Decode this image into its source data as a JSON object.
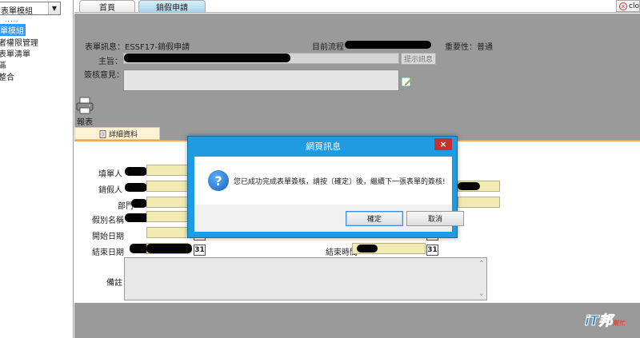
{
  "sidebar": {
    "module_select": "表單模組",
    "dots": ".....",
    "items": [
      "單模組",
      "者權限管理",
      "表單清單",
      "區",
      "整合"
    ]
  },
  "tabs": {
    "home": "首頁",
    "leave": "銷假申請",
    "close_label": "clo"
  },
  "form": {
    "info_label": "表單訊息：ESSF17-銷假申請",
    "flow_label": "目前流程",
    "importance_label": "重要性：普通",
    "manager_label": "主旨：",
    "hint_button": "提示訊息",
    "comment_label": "簽核意見：",
    "report_label": "報表",
    "detail_tab": "詳細資料",
    "applicant_label": "填單人",
    "leave_person_label": "銷假人",
    "dept_label": "部門",
    "leave_type_label": "假別名稱",
    "start_date_label": "開始日期",
    "end_date_label": "結束日期",
    "end_time_label": "結束時間",
    "calendar_icon_text": "31",
    "memo_label": "備註"
  },
  "dialog": {
    "title": "網頁訊息",
    "close": "×",
    "icon_glyph": "?",
    "message": "您已成功完成表單簽核，請按〔確定〕後，繼續下一張表單的簽核!",
    "ok": "確定",
    "cancel": "取消"
  },
  "watermark": {
    "text": "iT邦",
    "sub": "幫忙"
  }
}
